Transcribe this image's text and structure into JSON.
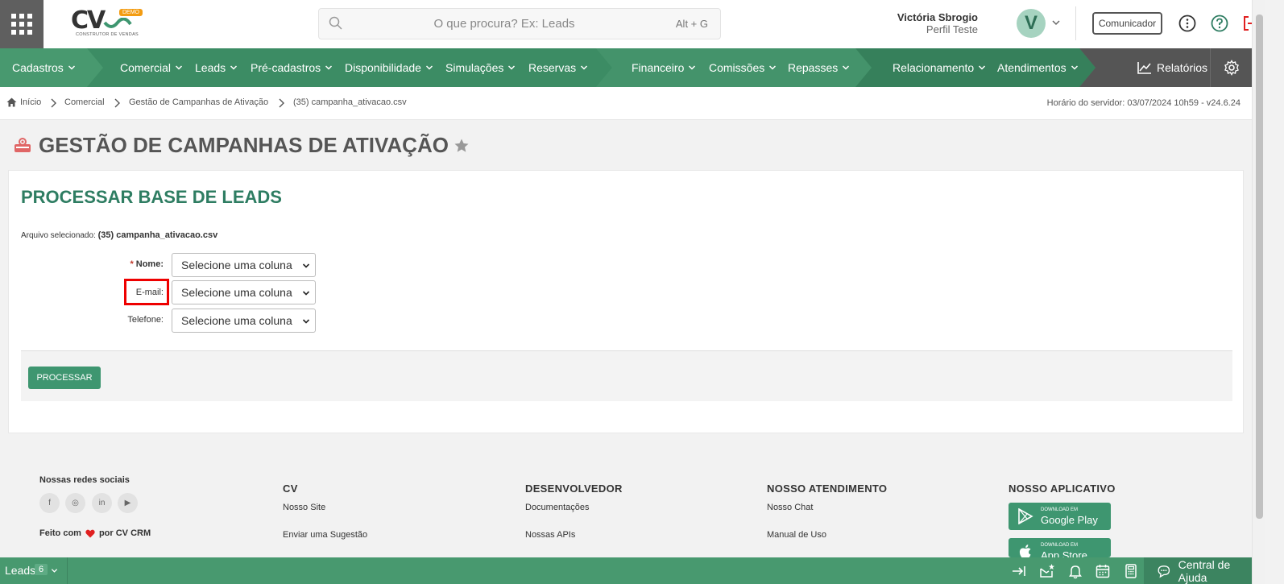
{
  "topbar": {
    "logo_text": "CV",
    "logo_badge": "DEMO",
    "logo_sub": "CONSTRUTOR DE VENDAS",
    "search_placeholder": "O que procura? Ex: Leads",
    "search_shortcut": "Alt + G",
    "user_name": "Victória Sbrogio",
    "user_profile": "Perfil Teste",
    "avatar_letter": "V",
    "comunicador": "Comunicador"
  },
  "nav": {
    "items": [
      "Cadastros",
      "Comercial",
      "Leads",
      "Pré-cadastros",
      "Disponibilidade",
      "Simulações",
      "Reservas",
      "Financeiro",
      "Comissões",
      "Repasses",
      "Relacionamento",
      "Atendimentos"
    ],
    "reports": "Relatórios"
  },
  "breadcrumb": {
    "items": [
      "Início",
      "Comercial",
      "Gestão de Campanhas de Ativação",
      "(35) campanha_ativacao.csv"
    ],
    "server_time": "Horário do servidor: 03/07/2024 10h59 - v24.6.24"
  },
  "page": {
    "title": "GESTÃO DE CAMPANHAS DE ATIVAÇÃO"
  },
  "form": {
    "section_title": "PROCESSAR BASE DE LEADS",
    "file_label": "Arquivo selecionado:",
    "file_name": "(35) campanha_ativacao.csv",
    "required_mark": "*",
    "fields": [
      {
        "label": "Nome:",
        "value": "Selecione uma coluna"
      },
      {
        "label": "E-mail:",
        "value": "Selecione uma coluna"
      },
      {
        "label": "Telefone:",
        "value": "Selecione uma coluna"
      }
    ],
    "process_button": "PROCESSAR"
  },
  "footer": {
    "social_heading": "Nossas redes sociais",
    "social_icons": [
      "f",
      "◎",
      "in",
      "▶"
    ],
    "made_with_prefix": "Feito com",
    "made_with_suffix": "por CV CRM",
    "columns": [
      {
        "heading": "CV",
        "links": [
          "Nosso Site",
          "Enviar uma Sugestão"
        ]
      },
      {
        "heading": "DESENVOLVEDOR",
        "links": [
          "Documentações",
          "Nossas APIs"
        ]
      },
      {
        "heading": "NOSSO ATENDIMENTO",
        "links": [
          "Nosso Chat",
          "Manual de Uso"
        ]
      },
      {
        "heading": "NOSSO APLICATIVO",
        "links": []
      }
    ],
    "google_small": "DOWNLOAD EM",
    "google_big": "Google Play",
    "apple_small": "DOWNLOAD EM",
    "apple_big": "App Store"
  },
  "bottombar": {
    "leads_label": "Leads",
    "leads_count": "6",
    "help_label": "Central de Ajuda"
  },
  "colors": {
    "nav_green": "#48996f",
    "title_green": "#2e7d62",
    "button_green": "#3e9670",
    "highlight_red": "#e00000"
  }
}
